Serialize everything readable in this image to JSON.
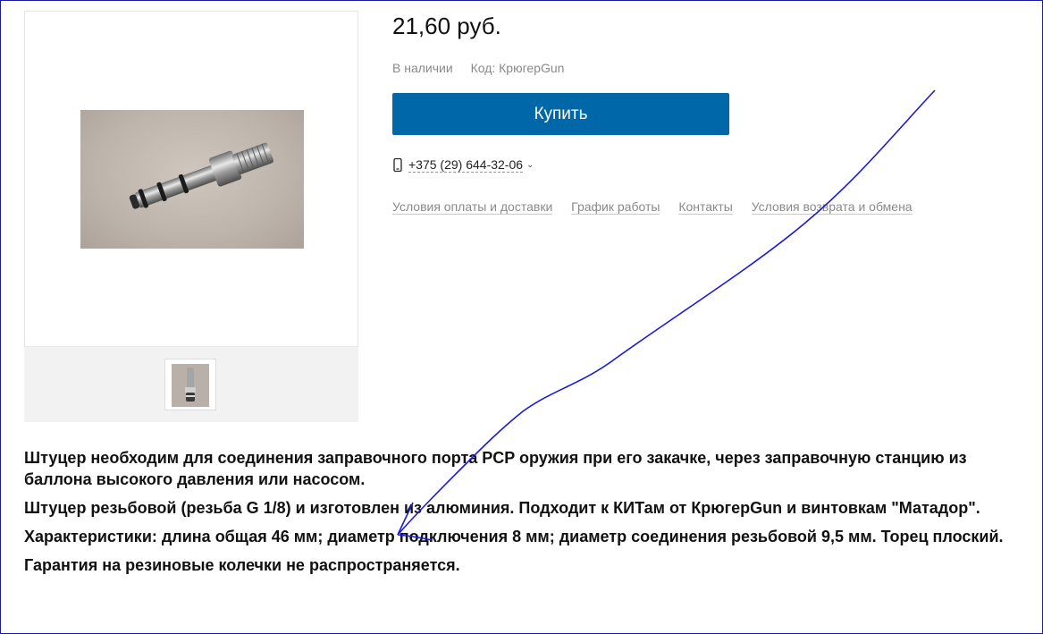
{
  "product": {
    "price": "21,60 руб.",
    "availability": "В наличии",
    "code": "Код: КрюгерGun",
    "buy_label": "Купить",
    "phone": "+375 (29) 644-32-06",
    "chevron": "⌄"
  },
  "links": [
    "Условия оплаты и доставки",
    "График работы",
    "Контакты",
    "Условия возврата и обмена"
  ],
  "description": [
    "Штуцер необходим для соединения заправочного порта PCP оружия при его закачке, через заправочную станцию из баллона высокого давления или насосом.",
    "Штуцер резьбовой (резьба G 1/8) и изготовлен из алюминия. Подходит к КИТам от КрюгерGun и винтовкам \"Матадор\".",
    "Характеристики: длина общая 46 мм; диаметр подключения 8 мм; диаметр соединения резьбовой 9,5 мм. Торец плоский.",
    "Гарантия на резиновые колечки не распространяется."
  ],
  "icons": {
    "phone": "phone-icon",
    "chevron": "chevron-down-icon"
  },
  "colors": {
    "accent": "#0068a8",
    "annotation": "#1a1adb",
    "frame": "#1a1aa6"
  }
}
